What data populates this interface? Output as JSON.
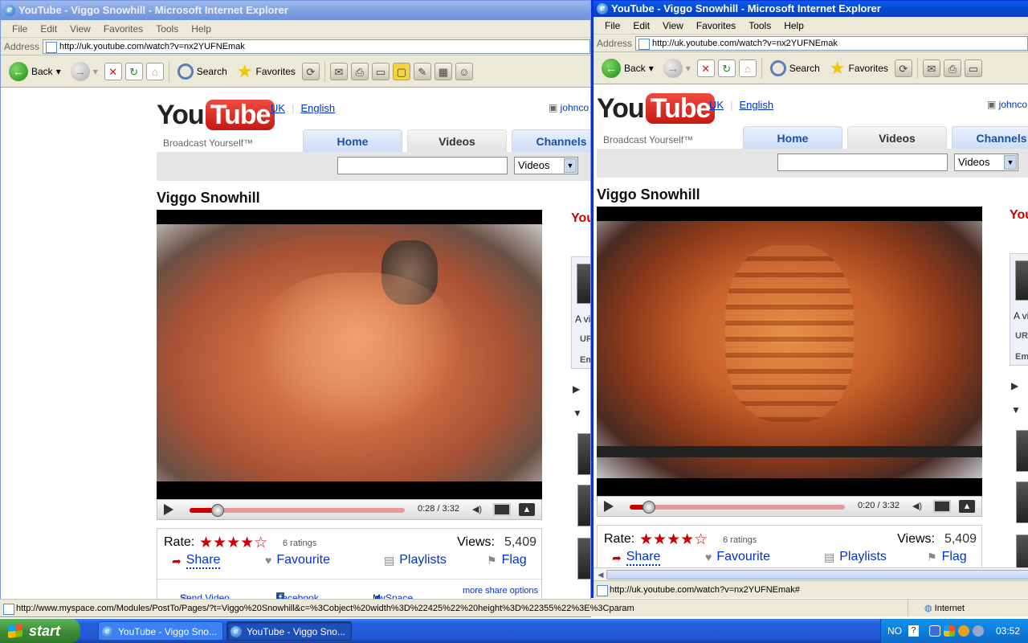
{
  "windows": {
    "left": {
      "title": "YouTube - Viggo Snowhill - Microsoft Internet Explorer",
      "address": "http://uk.youtube.com/watch?v=nx2YUFNEmak",
      "player_time": "0:28 / 3:32",
      "progress": 0.13
    },
    "right": {
      "title": "YouTube - Viggo Snowhill - Microsoft Internet Explorer",
      "address": "http://uk.youtube.com/watch?v=nx2YUFNEmak",
      "player_time": "0:20 / 3:32",
      "progress": 0.09,
      "status": "http://uk.youtube.com/watch?v=nx2YUFNEmak#"
    }
  },
  "menu": [
    "File",
    "Edit",
    "View",
    "Favorites",
    "Tools",
    "Help"
  ],
  "address_label": "Address",
  "toolbar": {
    "back": "Back",
    "search": "Search",
    "favorites": "Favorites"
  },
  "youtube": {
    "logo_you": "You",
    "logo_tube": "Tube",
    "tagline": "Broadcast Yourself™",
    "region": "UK",
    "language": "English",
    "user": "johnco",
    "tabs": [
      "Home",
      "Videos",
      "Channels"
    ],
    "search_category": "Videos",
    "video_title": "Viggo Snowhill",
    "rate_label": "Rate:",
    "stars": "★★★★☆",
    "ratings": "6 ratings",
    "views_label": "Views:",
    "views": "5,409",
    "actions": {
      "share": "Share",
      "favourite": "Favourite",
      "playlists": "Playlists",
      "flag": "Flag"
    },
    "share_options": {
      "send": "Send Video",
      "facebook": "Facebook",
      "myspace": "MySpace",
      "more": "more share options"
    },
    "sidebar_logo": "You",
    "sidebar_text_a": "A vi",
    "sidebar_url": "UR",
    "sidebar_embed": "Em"
  },
  "status_left": "http://www.myspace.com/Modules/PostTo/Pages/?t=Viggo%20Snowhill&c=%3Cobject%20width%3D%22425%22%20height%3D%22355%22%3E%3Cparam",
  "status_zone": "Internet",
  "taskbar": {
    "start": "start",
    "tasks": [
      "YouTube - Viggo Sno...",
      "YouTube - Viggo Sno..."
    ],
    "language": "NO",
    "help": "?",
    "clock": "03:52"
  }
}
